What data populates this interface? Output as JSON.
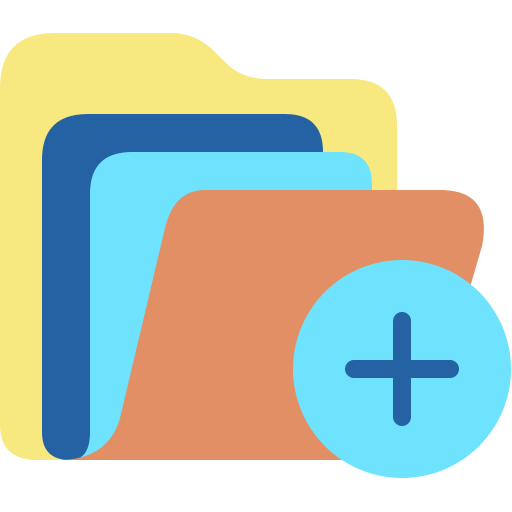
{
  "icon": {
    "name": "add-folder-icon",
    "colors": {
      "back_folder": "#f7e97f",
      "dark_sheet": "#2562a3",
      "light_sheet": "#6fe3fd",
      "front_folder": "#e38f66",
      "plus_badge": "#6fe3fd",
      "plus_sign": "#2562a3"
    }
  }
}
